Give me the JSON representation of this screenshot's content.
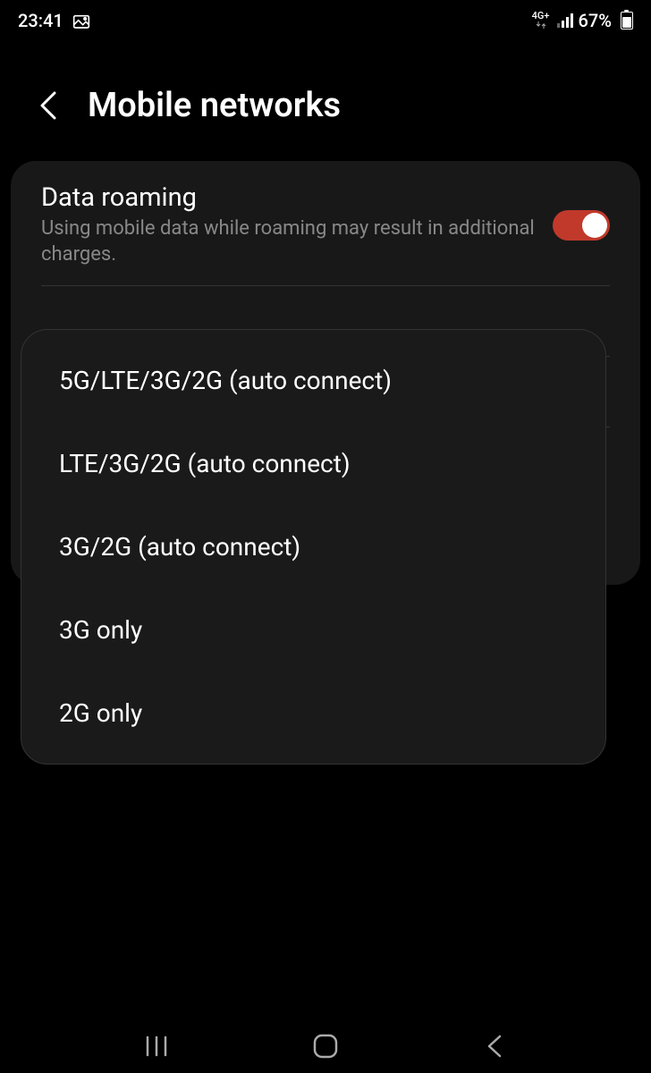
{
  "status_bar": {
    "time": "23:41",
    "network_type": "4G+",
    "battery_percent": "67%"
  },
  "header": {
    "title": "Mobile networks"
  },
  "settings": {
    "data_roaming": {
      "title": "Data roaming",
      "description": "Using mobile data while roaming may result in additional charges.",
      "enabled": true
    }
  },
  "network_mode_options": [
    "5G/LTE/3G/2G (auto connect)",
    "LTE/3G/2G (auto connect)",
    "3G/2G (auto connect)",
    "3G only",
    "2G only"
  ]
}
